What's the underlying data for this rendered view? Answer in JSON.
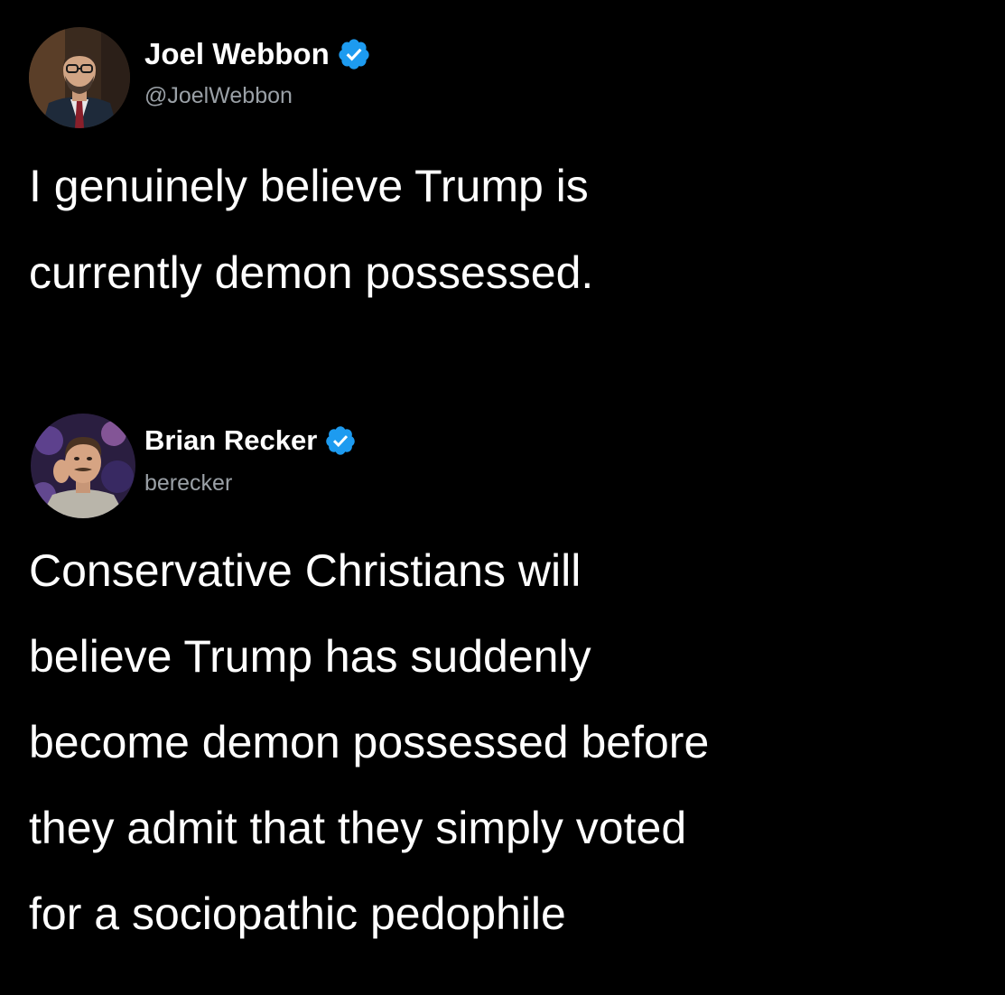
{
  "tweets": [
    {
      "display_name": "Joel Webbon",
      "handle": "@JoelWebbon",
      "verified": true,
      "avatar_icon": "profile-photo-man-suit-glasses",
      "text_lines": [
        "I genuinely believe Trump is",
        "currently demon possessed."
      ]
    },
    {
      "display_name": "Brian Recker",
      "handle": "berecker",
      "verified": true,
      "avatar_icon": "profile-photo-man-smiling",
      "text_lines": [
        "Conservative Christians will",
        "believe Trump has suddenly",
        "become demon possessed before",
        "they admit that they simply voted",
        "for a sociopathic pedophile"
      ]
    }
  ],
  "colors": {
    "background": "#000000",
    "text": "#ffffff",
    "handle": "#9aa0a6",
    "verified_badge": "#1d9bf0"
  }
}
